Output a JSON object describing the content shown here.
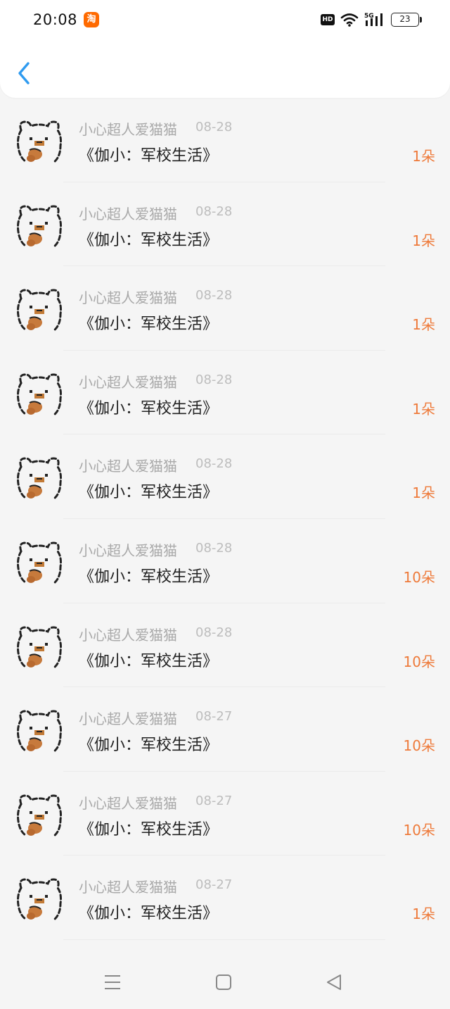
{
  "status_bar": {
    "time": "20:08",
    "app_badge": "淘",
    "hd": "HD",
    "network": "5G",
    "battery": "23",
    "icons": [
      "taobao-icon",
      "hd-icon",
      "wifi-icon",
      "signal-5g-icon",
      "battery-icon"
    ]
  },
  "header": {
    "back_icon": "chevron-left-icon",
    "accent_color": "#2f9bf0"
  },
  "list": {
    "amount_color": "#ee7a3a",
    "items": [
      {
        "name": "小心超人爱猫猫",
        "date": "08-28",
        "title": "《伽小：军校生活》",
        "amount": "1朵"
      },
      {
        "name": "小心超人爱猫猫",
        "date": "08-28",
        "title": "《伽小：军校生活》",
        "amount": "1朵"
      },
      {
        "name": "小心超人爱猫猫",
        "date": "08-28",
        "title": "《伽小：军校生活》",
        "amount": "1朵"
      },
      {
        "name": "小心超人爱猫猫",
        "date": "08-28",
        "title": "《伽小：军校生活》",
        "amount": "1朵"
      },
      {
        "name": "小心超人爱猫猫",
        "date": "08-28",
        "title": "《伽小：军校生活》",
        "amount": "1朵"
      },
      {
        "name": "小心超人爱猫猫",
        "date": "08-28",
        "title": "《伽小：军校生活》",
        "amount": "10朵"
      },
      {
        "name": "小心超人爱猫猫",
        "date": "08-28",
        "title": "《伽小：军校生活》",
        "amount": "10朵"
      },
      {
        "name": "小心超人爱猫猫",
        "date": "08-27",
        "title": "《伽小：军校生活》",
        "amount": "10朵"
      },
      {
        "name": "小心超人爱猫猫",
        "date": "08-27",
        "title": "《伽小：军校生活》",
        "amount": "10朵"
      },
      {
        "name": "小心超人爱猫猫",
        "date": "08-27",
        "title": "《伽小：军校生活》",
        "amount": "1朵"
      }
    ]
  },
  "nav": {
    "icons": [
      "menu-icon",
      "home-square-icon",
      "back-triangle-icon"
    ]
  }
}
